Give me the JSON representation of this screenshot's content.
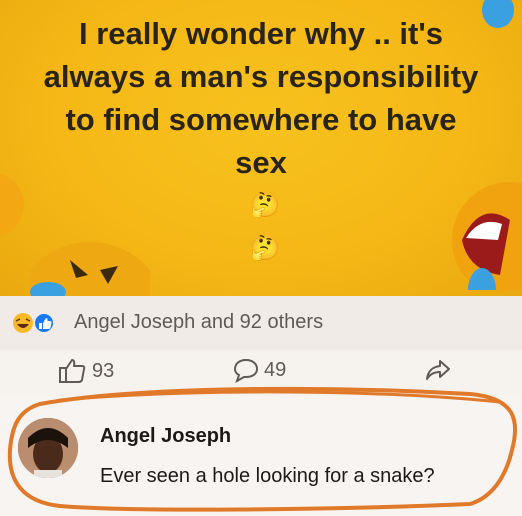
{
  "post": {
    "lines": [
      "I really wonder why .. it's",
      "always a man's responsibility",
      "to find somewhere to have",
      "sex"
    ],
    "emojis": [
      "🤔",
      "🤔"
    ]
  },
  "reactions": {
    "summary": "Angel Joseph and 92 others",
    "icons": [
      "haha-icon",
      "like-icon"
    ]
  },
  "actions": {
    "likes": "93",
    "comments": "49"
  },
  "comment": {
    "author": "Angel Joseph",
    "text": "Ever seen a hole looking for a snake?"
  },
  "colors": {
    "post_background": "#f5b816",
    "highlight": "#e0792a",
    "like_blue": "#1877f2"
  }
}
